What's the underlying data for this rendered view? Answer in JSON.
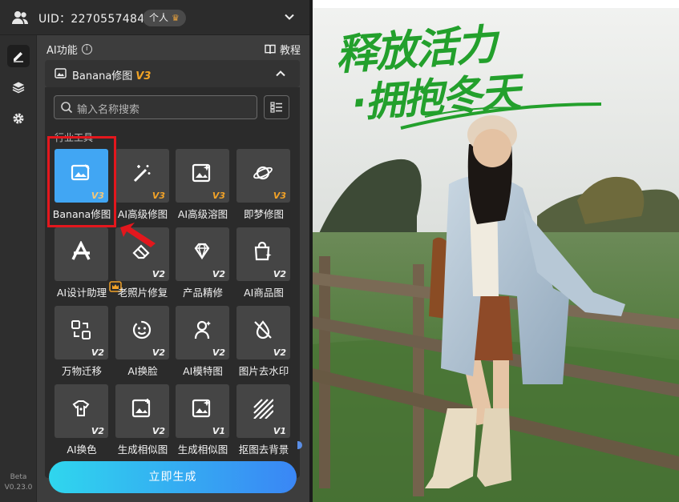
{
  "header": {
    "uid": "UID：2270557484",
    "account_badge": "个人",
    "badge_icon": "crown-icon",
    "expand_icon": "chevron-down-icon"
  },
  "nav": {
    "items": [
      {
        "name": "edit",
        "icon": "pencil-icon",
        "active": true
      },
      {
        "name": "layers",
        "icon": "layers-icon",
        "active": false
      },
      {
        "name": "settings",
        "icon": "gear-icon",
        "active": false
      }
    ],
    "beta_label": "Beta",
    "version": "V0.23.0"
  },
  "panel": {
    "section_title": "AI功能",
    "tutorial_label": "教程",
    "tool_group": {
      "name": "Banana修图",
      "version": "V3"
    },
    "search_placeholder": "输入名称搜索",
    "category": "行业工具",
    "generate_button": "立即生成"
  },
  "tools": [
    {
      "label": "Banana修图",
      "version": "V3",
      "icon": "image-edit-icon",
      "selected": true
    },
    {
      "label": "AI高级修图",
      "version": "V3",
      "icon": "magic-wand-icon"
    },
    {
      "label": "AI高级溶图",
      "version": "V3",
      "icon": "image-sparkle-icon"
    },
    {
      "label": "即梦修图",
      "version": "V3",
      "icon": "planet-icon"
    },
    {
      "label": "AI设计助理",
      "version": "",
      "icon": "design-a-icon",
      "badge_icon": "crown-badge-icon"
    },
    {
      "label": "老照片修复",
      "version": "V2",
      "icon": "eraser-icon"
    },
    {
      "label": "产品精修",
      "version": "V2",
      "icon": "diamond-icon"
    },
    {
      "label": "AI商品图",
      "version": "V2",
      "icon": "shopping-bag-icon"
    },
    {
      "label": "万物迁移",
      "version": "V2",
      "icon": "transfer-icon"
    },
    {
      "label": "AI换脸",
      "version": "V2",
      "icon": "face-icon"
    },
    {
      "label": "AI模特图",
      "version": "V2",
      "icon": "model-icon"
    },
    {
      "label": "图片去水印",
      "version": "V2",
      "icon": "no-watermark-icon"
    },
    {
      "label": "AI换色",
      "version": "V2",
      "icon": "palette-shirt-icon"
    },
    {
      "label": "生成相似图",
      "version": "V2",
      "icon": "image-plus-icon"
    },
    {
      "label": "生成相似图",
      "version": "V1",
      "icon": "image-star-icon"
    },
    {
      "label": "抠图去背景",
      "version": "V1",
      "icon": "stripes-icon"
    }
  ],
  "artwork": {
    "headline_line1": "释放活力",
    "headline_line2": "·拥抱冬天",
    "headline_color": "#23a02c"
  },
  "colors": {
    "accent_selected": "#41a6f3",
    "version_badge": "#f2a227",
    "highlight_box": "#e3171d",
    "generate_gradient_start": "#2fd6ee",
    "generate_gradient_end": "#3a86f5"
  }
}
